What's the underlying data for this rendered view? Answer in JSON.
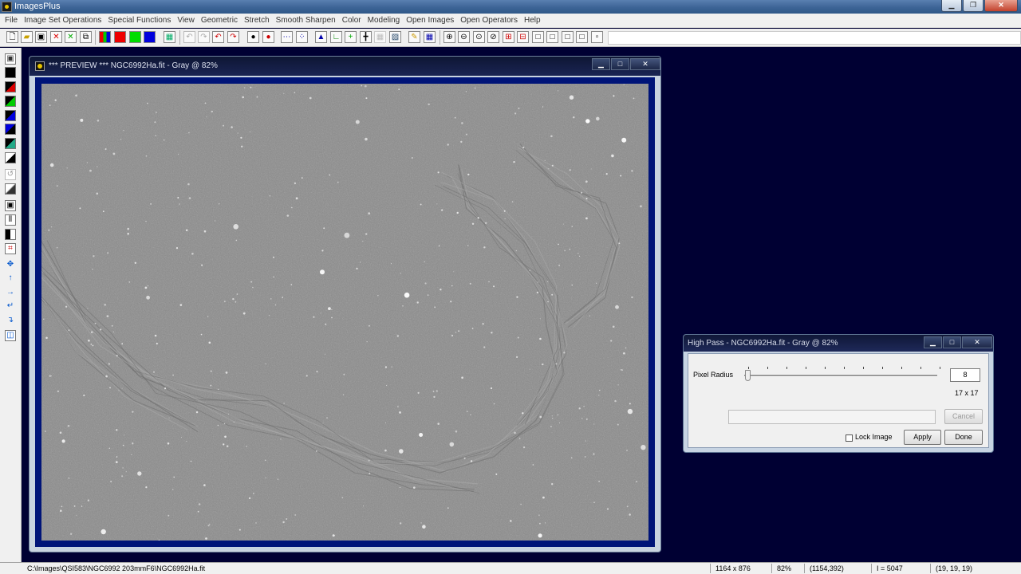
{
  "app": {
    "title": "ImagesPlus"
  },
  "menu": [
    "File",
    "Image Set Operations",
    "Special Functions",
    "View",
    "Geometric",
    "Stretch",
    "Smooth Sharpen",
    "Color",
    "Modeling",
    "Open Images",
    "Open Operators",
    "Help"
  ],
  "preview_window": {
    "title": "*** PREVIEW *** NGC6992Ha.fit - Gray @ 82%"
  },
  "dialog": {
    "title": "High Pass - NGC6992Ha.fit - Gray @ 82%",
    "pixel_radius_label": "Pixel Radius",
    "pixel_radius_value": "8",
    "kernel_size": "17 x 17",
    "cancel_label": "Cancel",
    "lock_image_label": "Lock Image",
    "apply_label": "Apply",
    "done_label": "Done"
  },
  "status": {
    "path": "C:\\Images\\QSI583\\NGC6992 203mmF6\\NGC6992Ha.fit",
    "dimensions": "1164 x 876",
    "zoom": "82%",
    "coords": "(1154,392)",
    "intensity": "I = 5047",
    "rgb": "(19, 19, 19)"
  },
  "colors": {
    "desktop": "#000033",
    "image_frame": "#001478"
  },
  "icons": {
    "toolbar": [
      "new-file-icon",
      "open-folder-icon",
      "save-icon",
      "close-red-x-icon",
      "close-green-x-icon",
      "copy-icon",
      "rgb-channels-icon",
      "red-channel-icon",
      "green-channel-icon",
      "blue-channel-icon",
      "grid-icon",
      "undo-icon",
      "redo-icon",
      "undo-red-icon",
      "redo-red-icon",
      "circle-black-icon",
      "circle-red-icon",
      "dotted-line-icon",
      "dotted-point-icon",
      "histogram-icon",
      "axis-icon",
      "crosshair-green-icon",
      "crosshair-icon",
      "blank-grid-icon",
      "image-tools-icon",
      "pencil-icon",
      "table-icon",
      "zoom-in-icon",
      "zoom-out-icon",
      "zoom-fit-icon",
      "zoom-reset-icon",
      "add-box-icon",
      "subtract-box-icon",
      "square-icon",
      "square-2-icon",
      "square-3-icon",
      "square-4-icon",
      "square-small-icon"
    ],
    "left_toolbar": [
      "save-small-icon",
      "black-square-icon",
      "red-black-icon",
      "green-black-icon",
      "blue-black-icon",
      "blue-square-icon",
      "black-fill-icon",
      "invert-icon",
      "gradient-icon",
      "mask-icon",
      "levels-icon",
      "black-bar-icon",
      "crop-icon",
      "move-icon",
      "arrow-up-icon",
      "arrow-right-icon",
      "rotate-left-icon",
      "rotate-right-icon",
      "flip-icon"
    ]
  }
}
